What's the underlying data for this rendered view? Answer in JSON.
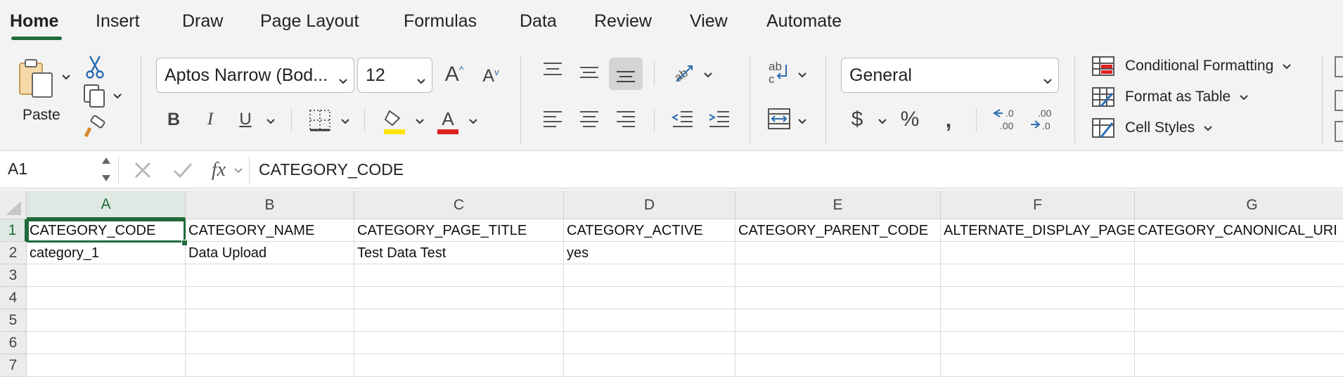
{
  "ribbon_tabs": [
    "Home",
    "Insert",
    "Draw",
    "Page Layout",
    "Formulas",
    "Data",
    "Review",
    "View",
    "Automate"
  ],
  "active_tab": "Home",
  "clipboard": {
    "paste_label": "Paste"
  },
  "font": {
    "name": "Aptos Narrow (Bod...",
    "size": "12"
  },
  "number": {
    "format": "General"
  },
  "styles": {
    "conditional_formatting": "Conditional Formatting",
    "format_as_table": "Format as Table",
    "cell_styles": "Cell Styles"
  },
  "formula_bar": {
    "name_box": "A1",
    "fx": "fx",
    "formula": "CATEGORY_CODE"
  },
  "grid": {
    "columns": [
      "A",
      "B",
      "C",
      "D",
      "E",
      "F",
      "G"
    ],
    "rows": [
      "1",
      "2",
      "3",
      "4",
      "5",
      "6",
      "7"
    ],
    "cells": [
      [
        "CATEGORY_CODE",
        "CATEGORY_NAME",
        "CATEGORY_PAGE_TITLE",
        "CATEGORY_ACTIVE",
        "CATEGORY_PARENT_CODE",
        "ALTERNATE_DISPLAY_PAGE",
        "CATEGORY_CANONICAL_URI"
      ],
      [
        "category_1",
        "Data Upload",
        "Test Data Test",
        "yes",
        "",
        "",
        ""
      ],
      [
        "",
        "",
        "",
        "",
        "",
        "",
        ""
      ],
      [
        "",
        "",
        "",
        "",
        "",
        "",
        ""
      ],
      [
        "",
        "",
        "",
        "",
        "",
        "",
        ""
      ],
      [
        "",
        "",
        "",
        "",
        "",
        "",
        ""
      ],
      [
        "",
        "",
        "",
        "",
        "",
        "",
        ""
      ]
    ]
  },
  "colors": {
    "accent": "#1f6b3a",
    "fill_color": "#ffe600",
    "font_color": "#e02020"
  }
}
